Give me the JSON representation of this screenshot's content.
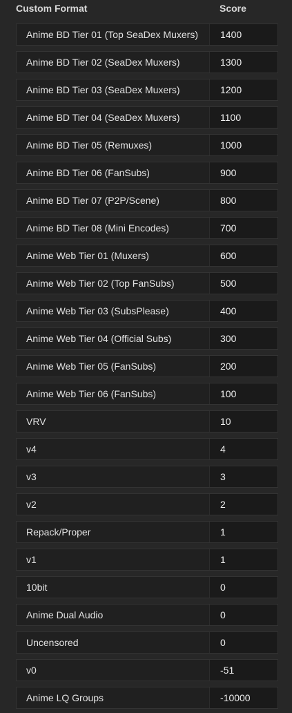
{
  "header": {
    "format_label": "Custom Format",
    "score_label": "Score"
  },
  "rows": [
    {
      "name": "Anime BD Tier 01 (Top SeaDex Muxers)",
      "score": "1400"
    },
    {
      "name": "Anime BD Tier 02 (SeaDex Muxers)",
      "score": "1300"
    },
    {
      "name": "Anime BD Tier 03 (SeaDex Muxers)",
      "score": "1200"
    },
    {
      "name": "Anime BD Tier 04 (SeaDex Muxers)",
      "score": "1100"
    },
    {
      "name": "Anime BD Tier 05 (Remuxes)",
      "score": "1000"
    },
    {
      "name": "Anime BD Tier 06 (FanSubs)",
      "score": "900"
    },
    {
      "name": "Anime BD Tier 07 (P2P/Scene)",
      "score": "800"
    },
    {
      "name": "Anime BD Tier 08 (Mini Encodes)",
      "score": "700"
    },
    {
      "name": "Anime Web Tier 01 (Muxers)",
      "score": "600"
    },
    {
      "name": "Anime Web Tier 02 (Top FanSubs)",
      "score": "500"
    },
    {
      "name": "Anime Web Tier 03 (SubsPlease)",
      "score": "400"
    },
    {
      "name": "Anime Web Tier 04 (Official Subs)",
      "score": "300"
    },
    {
      "name": "Anime Web Tier 05 (FanSubs)",
      "score": "200"
    },
    {
      "name": "Anime Web Tier 06 (FanSubs)",
      "score": "100"
    },
    {
      "name": "VRV",
      "score": "10"
    },
    {
      "name": "v4",
      "score": "4"
    },
    {
      "name": "v3",
      "score": "3"
    },
    {
      "name": "v2",
      "score": "2"
    },
    {
      "name": "Repack/Proper",
      "score": "1"
    },
    {
      "name": "v1",
      "score": "1"
    },
    {
      "name": "10bit",
      "score": "0"
    },
    {
      "name": "Anime Dual Audio",
      "score": "0"
    },
    {
      "name": "Uncensored",
      "score": "0"
    },
    {
      "name": "v0",
      "score": "-51"
    },
    {
      "name": "Anime LQ Groups",
      "score": "-10000"
    }
  ]
}
